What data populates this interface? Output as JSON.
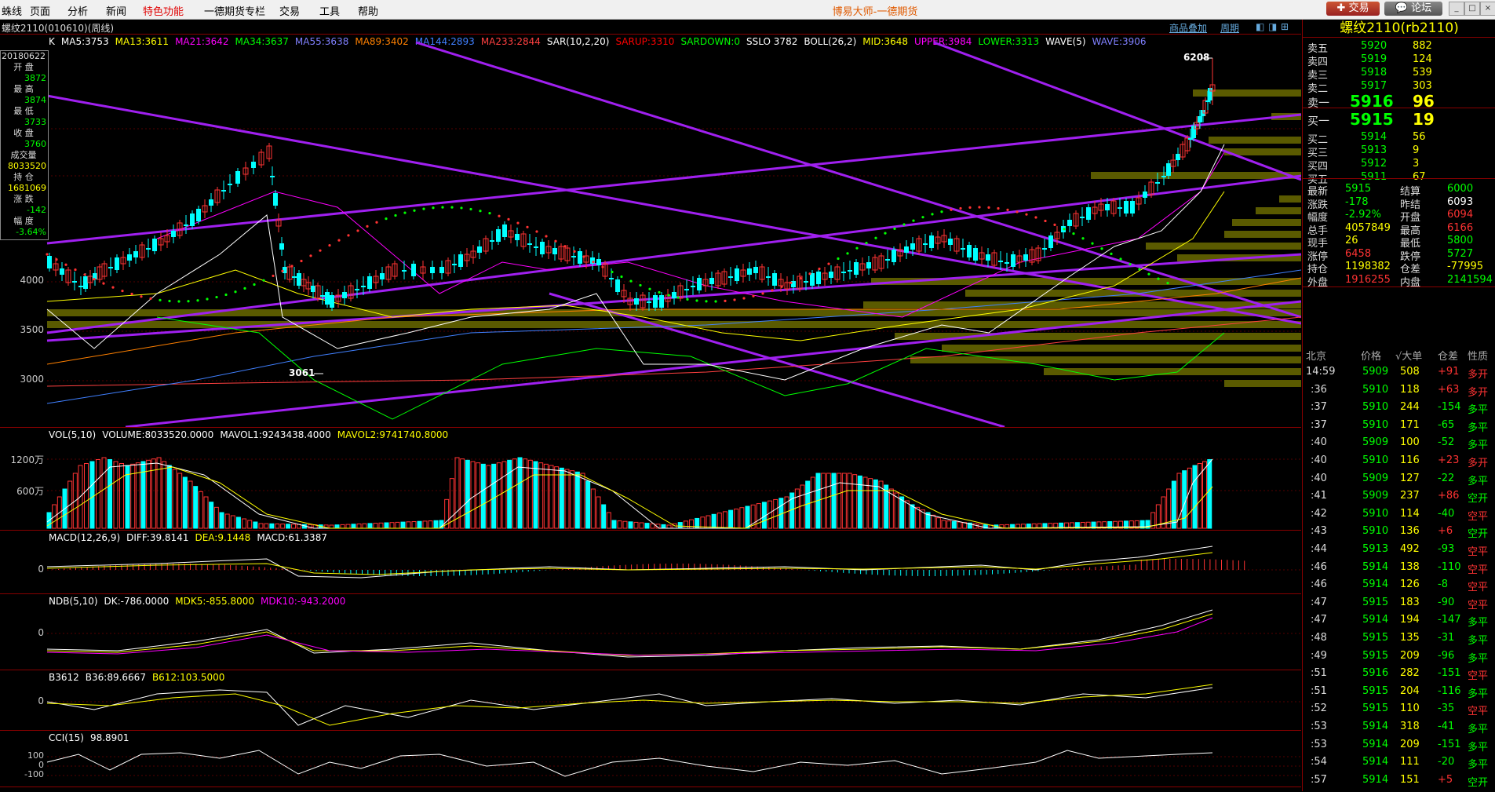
{
  "menu": {
    "items": [
      "蛛线",
      "页面",
      "分析",
      "新闻",
      "特色功能",
      "一德期货专栏",
      "交易",
      "工具",
      "帮助"
    ],
    "hot_index": 4
  },
  "app_title": "博易大师-一德期货",
  "top_buttons": {
    "trade": "交易",
    "forum": "论坛"
  },
  "subbar": {
    "symbol": "螺纹2110(010610)(周线)",
    "overlay": "商品叠加",
    "period": "周期"
  },
  "main_legend": [
    {
      "t": "K",
      "c": "#ffffff"
    },
    {
      "t": "MA5:3753",
      "c": "#ffffff"
    },
    {
      "t": "MA13:3611",
      "c": "#ffff00"
    },
    {
      "t": "MA21:3642",
      "c": "#ff00ff"
    },
    {
      "t": "MA34:3637",
      "c": "#00ff00"
    },
    {
      "t": "MA55:3638",
      "c": "#8080ff"
    },
    {
      "t": "MA89:3402",
      "c": "#ff8000"
    },
    {
      "t": "MA144:2893",
      "c": "#4080ff"
    },
    {
      "t": "MA233:2844",
      "c": "#ff4040"
    },
    {
      "t": "SAR(10,2,20)",
      "c": "#ffffff"
    },
    {
      "t": "SARUP:3310",
      "c": "#ff0000"
    },
    {
      "t": "SARDOWN:0",
      "c": "#00ff00"
    },
    {
      "t": "SSLO 3782",
      "c": "#ffffff"
    },
    {
      "t": "BOLL(26,2)",
      "c": "#ffffff"
    },
    {
      "t": "MID:3648",
      "c": "#ffff00"
    },
    {
      "t": "UPPER:3984",
      "c": "#ff00ff"
    },
    {
      "t": "LOWER:3313",
      "c": "#00ff00"
    },
    {
      "t": "WAVE(5)",
      "c": "#ffffff"
    },
    {
      "t": "WAVE:3906",
      "c": "#8080ff"
    }
  ],
  "info_box": [
    {
      "k": "20180622",
      "v": ""
    },
    {
      "k": "开 盘",
      "v": "3872",
      "c": "#00ff00"
    },
    {
      "k": "最 高",
      "v": "3874",
      "c": "#00ff00"
    },
    {
      "k": "最 低",
      "v": "3733",
      "c": "#00ff00"
    },
    {
      "k": "收 盘",
      "v": "3760",
      "c": "#00ff00"
    },
    {
      "k": "成交量",
      "v": "8033520",
      "c": "#ffff00"
    },
    {
      "k": "持 仓",
      "v": "1681069",
      "c": "#ffff00"
    },
    {
      "k": "涨 跌",
      "v": "-142",
      "c": "#00ff00"
    },
    {
      "k": "幅 度",
      "v": "-3.64%",
      "c": "#00ff00"
    }
  ],
  "main_axis": [
    "4000",
    "3500",
    "3000"
  ],
  "annotations": {
    "high": "6208",
    "low": "3061"
  },
  "vol_legend": [
    {
      "t": "VOL(5,10)",
      "c": "#ffffff"
    },
    {
      "t": "VOLUME:8033520.0000",
      "c": "#ffffff"
    },
    {
      "t": "MAVOL1:9243438.4000",
      "c": "#ffffff"
    },
    {
      "t": "MAVOL2:9741740.8000",
      "c": "#ffff00"
    }
  ],
  "vol_axis": [
    "1200万",
    "600万"
  ],
  "macd_legend": [
    {
      "t": "MACD(12,26,9)",
      "c": "#ffffff"
    },
    {
      "t": "DIFF:39.8141",
      "c": "#ffffff"
    },
    {
      "t": "DEA:9.1448",
      "c": "#ffff00"
    },
    {
      "t": "MACD:61.3387",
      "c": "#ffffff"
    }
  ],
  "ndb_legend": [
    {
      "t": "NDB(5,10)",
      "c": "#ffffff"
    },
    {
      "t": "DK:-786.0000",
      "c": "#ffffff"
    },
    {
      "t": "MDK5:-855.8000",
      "c": "#ffff00"
    },
    {
      "t": "MDK10:-943.2000",
      "c": "#ff00ff"
    }
  ],
  "b3612_legend": [
    {
      "t": "B3612",
      "c": "#ffffff"
    },
    {
      "t": "B36:89.6667",
      "c": "#ffffff"
    },
    {
      "t": "B612:103.5000",
      "c": "#ffff00"
    }
  ],
  "cci_legend": [
    {
      "t": "CCI(15)",
      "c": "#ffffff"
    },
    {
      "t": "98.8901",
      "c": "#ffffff"
    }
  ],
  "zero": "0",
  "cci_axis": [
    "100",
    "0",
    "-100"
  ],
  "quote": {
    "title": "螺纹2110(rb2110)",
    "asks": [
      {
        "label": "卖五",
        "price": "5920",
        "vol": "882"
      },
      {
        "label": "卖四",
        "price": "5919",
        "vol": "124"
      },
      {
        "label": "卖三",
        "price": "5918",
        "vol": "539"
      },
      {
        "label": "卖二",
        "price": "5917",
        "vol": "303"
      },
      {
        "label": "卖一",
        "price": "5916",
        "vol": "96"
      }
    ],
    "bids": [
      {
        "label": "买一",
        "price": "5915",
        "vol": "19"
      },
      {
        "label": "买二",
        "price": "5914",
        "vol": "56"
      },
      {
        "label": "买三",
        "price": "5913",
        "vol": "9"
      },
      {
        "label": "买四",
        "price": "5912",
        "vol": "3"
      },
      {
        "label": "买五",
        "price": "5911",
        "vol": "67"
      }
    ],
    "stats": [
      {
        "l1": "最新",
        "v1": "5915",
        "c1": "#00ff00",
        "l2": "结算",
        "v2": "6000",
        "c2": "#00ff00"
      },
      {
        "l1": "涨跌",
        "v1": "-178",
        "c1": "#00ff00",
        "l2": "昨结",
        "v2": "6093",
        "c2": "#ffffff"
      },
      {
        "l1": "幅度",
        "v1": "-2.92%",
        "c1": "#00ff00",
        "l2": "开盘",
        "v2": "6094",
        "c2": "#ff3333"
      },
      {
        "l1": "总手",
        "v1": "4057849",
        "c1": "#ffff00",
        "l2": "最高",
        "v2": "6166",
        "c2": "#ff3333"
      },
      {
        "l1": "现手",
        "v1": "26",
        "c1": "#ffff00",
        "l2": "最低",
        "v2": "5800",
        "c2": "#00ff00"
      },
      {
        "l1": "涨停",
        "v1": "6458",
        "c1": "#ff3333",
        "l2": "跌停",
        "v2": "5727",
        "c2": "#00ff00"
      },
      {
        "l1": "持仓",
        "v1": "1198382",
        "c1": "#ffff00",
        "l2": "仓差",
        "v2": "-77995",
        "c2": "#ffff00"
      },
      {
        "l1": "外盘",
        "v1": "1916255",
        "c1": "#ff3333",
        "l2": "内盘",
        "v2": "2141594",
        "c2": "#00ff00"
      }
    ],
    "trade_header": {
      "loc": "北京",
      "price": "价格",
      "vol": "√大单",
      "oi": "仓差",
      "type": "性质"
    },
    "trades": [
      {
        "t": "14:59",
        "p": "5909",
        "v": "508",
        "d": "+91",
        "n": "多开",
        "dc": "#ff3333",
        "nc": "#ff3333"
      },
      {
        "t": ":36",
        "p": "5910",
        "v": "118",
        "d": "+63",
        "n": "多开",
        "dc": "#ff3333",
        "nc": "#ff3333"
      },
      {
        "t": ":37",
        "p": "5910",
        "v": "244",
        "d": "-154",
        "n": "多平",
        "dc": "#00ff00",
        "nc": "#00ff00"
      },
      {
        "t": ":37",
        "p": "5910",
        "v": "171",
        "d": "-65",
        "n": "多平",
        "dc": "#00ff00",
        "nc": "#00ff00"
      },
      {
        "t": ":40",
        "p": "5909",
        "v": "100",
        "d": "-52",
        "n": "多平",
        "dc": "#00ff00",
        "nc": "#00ff00"
      },
      {
        "t": ":40",
        "p": "5910",
        "v": "116",
        "d": "+23",
        "n": "多开",
        "dc": "#ff3333",
        "nc": "#ff3333"
      },
      {
        "t": ":40",
        "p": "5909",
        "v": "127",
        "d": "-22",
        "n": "多平",
        "dc": "#00ff00",
        "nc": "#00ff00"
      },
      {
        "t": ":41",
        "p": "5909",
        "v": "237",
        "d": "+86",
        "n": "空开",
        "dc": "#ff3333",
        "nc": "#00ff00"
      },
      {
        "t": ":42",
        "p": "5910",
        "v": "114",
        "d": "-40",
        "n": "空平",
        "dc": "#00ff00",
        "nc": "#ff3333"
      },
      {
        "t": ":43",
        "p": "5910",
        "v": "136",
        "d": "+6",
        "n": "空开",
        "dc": "#ff3333",
        "nc": "#00ff00"
      },
      {
        "t": ":44",
        "p": "5913",
        "v": "492",
        "d": "-93",
        "n": "空平",
        "dc": "#00ff00",
        "nc": "#ff3333"
      },
      {
        "t": ":46",
        "p": "5914",
        "v": "138",
        "d": "-110",
        "n": "空平",
        "dc": "#00ff00",
        "nc": "#ff3333"
      },
      {
        "t": ":46",
        "p": "5914",
        "v": "126",
        "d": "-8",
        "n": "空平",
        "dc": "#00ff00",
        "nc": "#ff3333"
      },
      {
        "t": ":47",
        "p": "5915",
        "v": "183",
        "d": "-90",
        "n": "空平",
        "dc": "#00ff00",
        "nc": "#ff3333"
      },
      {
        "t": ":47",
        "p": "5914",
        "v": "194",
        "d": "-147",
        "n": "多平",
        "dc": "#00ff00",
        "nc": "#00ff00"
      },
      {
        "t": ":48",
        "p": "5915",
        "v": "135",
        "d": "-31",
        "n": "多平",
        "dc": "#00ff00",
        "nc": "#00ff00"
      },
      {
        "t": ":49",
        "p": "5915",
        "v": "209",
        "d": "-96",
        "n": "多平",
        "dc": "#00ff00",
        "nc": "#00ff00"
      },
      {
        "t": ":51",
        "p": "5916",
        "v": "282",
        "d": "-151",
        "n": "空平",
        "dc": "#00ff00",
        "nc": "#ff3333"
      },
      {
        "t": ":51",
        "p": "5915",
        "v": "204",
        "d": "-116",
        "n": "多平",
        "dc": "#00ff00",
        "nc": "#00ff00"
      },
      {
        "t": ":52",
        "p": "5915",
        "v": "110",
        "d": "-35",
        "n": "空平",
        "dc": "#00ff00",
        "nc": "#ff3333"
      },
      {
        "t": ":53",
        "p": "5914",
        "v": "318",
        "d": "-41",
        "n": "多平",
        "dc": "#00ff00",
        "nc": "#00ff00"
      },
      {
        "t": ":53",
        "p": "5914",
        "v": "209",
        "d": "-151",
        "n": "多平",
        "dc": "#00ff00",
        "nc": "#00ff00"
      },
      {
        "t": ":54",
        "p": "5914",
        "v": "111",
        "d": "-20",
        "n": "多平",
        "dc": "#00ff00",
        "nc": "#00ff00"
      },
      {
        "t": ":57",
        "p": "5914",
        "v": "151",
        "d": "+5",
        "n": "空开",
        "dc": "#ff3333",
        "nc": "#00ff00"
      }
    ]
  }
}
